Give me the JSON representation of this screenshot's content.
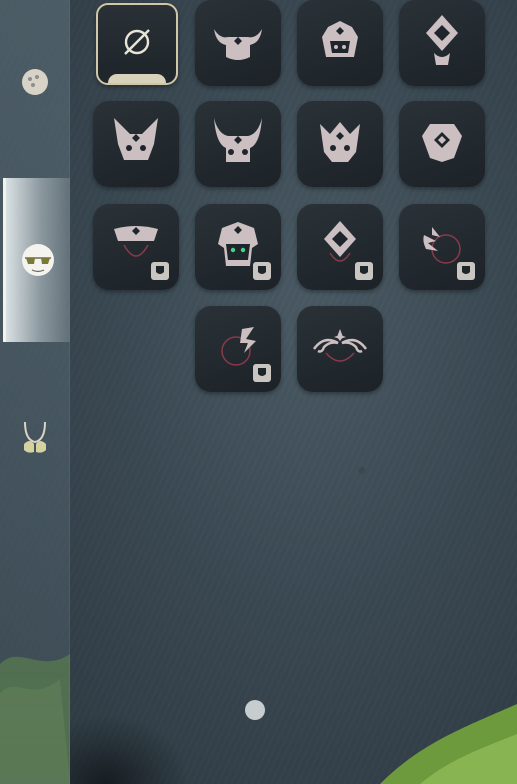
{
  "sidebar": {
    "tabs": [
      {
        "icon": "face-paint-icon",
        "active": false
      },
      {
        "icon": "glasses-icon",
        "active": true
      },
      {
        "icon": "necklace-icon",
        "active": false
      }
    ]
  },
  "grid": {
    "slots": [
      {
        "icon": "none-icon",
        "selected": true,
        "owned_badge": false
      },
      {
        "icon": "horned-mask-icon",
        "owned_badge": false
      },
      {
        "icon": "crested-mask-icon",
        "owned_badge": false
      },
      {
        "icon": "diamond-totem-icon",
        "owned_badge": false
      },
      {
        "icon": "eared-mask-icon",
        "owned_badge": false
      },
      {
        "icon": "curved-horn-mask-icon",
        "owned_badge": false
      },
      {
        "icon": "crown-mask-icon",
        "owned_badge": false
      },
      {
        "icon": "shield-crest-icon",
        "owned_badge": false
      },
      {
        "icon": "visor-mask-icon",
        "owned_badge": true
      },
      {
        "icon": "helmet-green-eyes-icon",
        "owned_badge": true
      },
      {
        "icon": "diamond-face-icon",
        "owned_badge": true
      },
      {
        "icon": "flame-face-icon",
        "owned_badge": true
      },
      {
        "icon": "flame-face-alt-icon",
        "owned_badge": true
      },
      {
        "icon": "curl-crown-icon",
        "owned_badge": false
      }
    ]
  },
  "colors": {
    "slot_bg": "#1f262b",
    "icon": "#c9bfc2",
    "accent_red": "#8a3a48",
    "selected_border": "#cfc7a8"
  }
}
